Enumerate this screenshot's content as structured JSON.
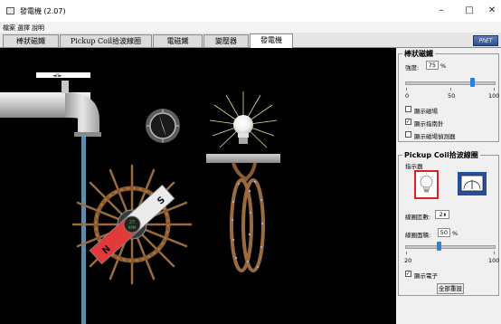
{
  "window": {
    "title": "發電機 (2.07)",
    "minimize": "–",
    "maximize": "□",
    "close": "✕"
  },
  "menu": [
    "檔案",
    "選擇",
    "說明"
  ],
  "tabs": [
    "棒狀磁鐵",
    "Pickup Coil拾波線圈",
    "電磁鐵",
    "變壓器",
    "發電機"
  ],
  "active_tab": 4,
  "logo": "PhET",
  "canvas": {
    "faucet_label": "◄II►",
    "magnet_s": "S",
    "magnet_n": "N",
    "rpm_value": "27",
    "rpm_unit": "RPM"
  },
  "bar_magnet_panel": {
    "title": "棒狀磁鐵",
    "strength_label": "強度:",
    "strength_value": "75",
    "strength_unit": "%",
    "strength_fraction": 0.75,
    "ticks": [
      "0",
      "50",
      "100"
    ],
    "checkboxes": [
      {
        "label": "顯示磁場",
        "checked": false
      },
      {
        "label": "顯示指南針",
        "checked": true
      },
      {
        "label": "顯示磁場偵測器",
        "checked": false
      }
    ]
  },
  "pickup_panel": {
    "title": "Pickup Coil拾波線圈",
    "indicator_label": "指示器",
    "loops_label": "線圈匝數:",
    "loops_value": "2",
    "area_label": "線圈面積:",
    "area_value": "50",
    "area_unit": "%",
    "area_fraction": 0.375,
    "ticks": [
      "20",
      "100"
    ],
    "electrons_label": "顯示電子",
    "electrons_checked": true,
    "reset_button": "全部重設"
  },
  "colors": {
    "accent": "#2f7fe0",
    "indicator_selected": "#e02020",
    "background": "#000000"
  }
}
